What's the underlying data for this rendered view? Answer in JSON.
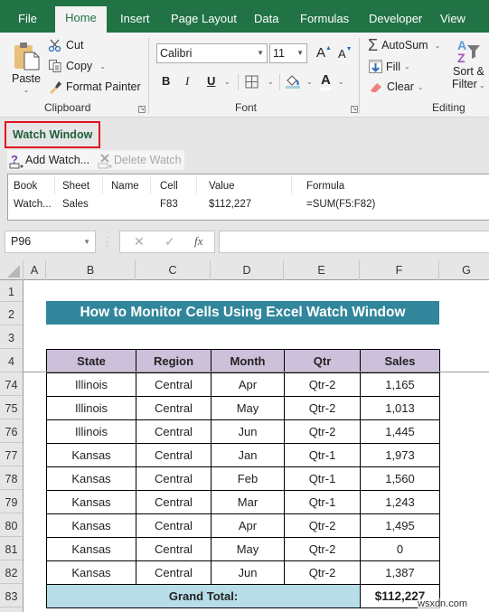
{
  "ribbon_tabs": [
    {
      "label": "File",
      "active": false
    },
    {
      "label": "Home",
      "active": true
    },
    {
      "label": "Insert",
      "active": false
    },
    {
      "label": "Page Layout",
      "active": false
    },
    {
      "label": "Data",
      "active": false
    },
    {
      "label": "Formulas",
      "active": false
    },
    {
      "label": "Developer",
      "active": false
    },
    {
      "label": "View",
      "active": false
    }
  ],
  "clipboard": {
    "paste": "Paste",
    "cut": "Cut",
    "copy": "Copy",
    "format_painter": "Format Painter",
    "group_label": "Clipboard"
  },
  "font": {
    "font_name": "Calibri",
    "font_size": "11",
    "bold": "B",
    "italic": "I",
    "underline": "U",
    "font_color_glyph": "A",
    "grow_glyph": "A",
    "shrink_glyph": "A",
    "group_label": "Font"
  },
  "editing": {
    "autosum": "AutoSum",
    "fill": "Fill",
    "clear": "Clear",
    "sort_filter_line1": "Sort &",
    "sort_filter_line2": "Filter",
    "group_label": "Editing"
  },
  "watch_window": {
    "title": "Watch Window",
    "add_watch": "Add Watch...",
    "delete_watch": "Delete Watch",
    "columns": [
      "Book",
      "Sheet",
      "Name",
      "Cell",
      "Value",
      "Formula"
    ],
    "rows": [
      {
        "book": "Watch...",
        "sheet": "Sales",
        "name": "",
        "cell": "F83",
        "value": "$112,227",
        "formula": "=SUM(F5:F82)"
      }
    ]
  },
  "formula_bar": {
    "name_box": "P96",
    "cancel_glyph": "✕",
    "enter_glyph": "✓",
    "fx_label": "fx",
    "formula_value": ""
  },
  "column_headers": [
    "A",
    "B",
    "C",
    "D",
    "E",
    "F",
    "G"
  ],
  "row_headers": [
    "1",
    "2",
    "3",
    "4",
    "74",
    "75",
    "76",
    "77",
    "78",
    "79",
    "80",
    "81",
    "82",
    "83"
  ],
  "sheet": {
    "title": "How to Monitor Cells Using Excel Watch Window",
    "table_headers": [
      "State",
      "Region",
      "Month",
      "Qtr",
      "Sales"
    ],
    "rows": [
      [
        "Illinois",
        "Central",
        "Apr",
        "Qtr-2",
        "1,165"
      ],
      [
        "Illinois",
        "Central",
        "May",
        "Qtr-2",
        "1,013"
      ],
      [
        "Illinois",
        "Central",
        "Jun",
        "Qtr-2",
        "1,445"
      ],
      [
        "Kansas",
        "Central",
        "Jan",
        "Qtr-1",
        "1,973"
      ],
      [
        "Kansas",
        "Central",
        "Feb",
        "Qtr-1",
        "1,560"
      ],
      [
        "Kansas",
        "Central",
        "Mar",
        "Qtr-1",
        "1,243"
      ],
      [
        "Kansas",
        "Central",
        "Apr",
        "Qtr-2",
        "1,495"
      ],
      [
        "Kansas",
        "Central",
        "May",
        "Qtr-2",
        "0"
      ],
      [
        "Kansas",
        "Central",
        "Jun",
        "Qtr-2",
        "1,387"
      ]
    ],
    "grand_total_label": "Grand Total:",
    "grand_total_value": "$112,227"
  },
  "colors": {
    "ribbon_green": "#217346",
    "title_banner": "#31869b",
    "header_fill": "#ccc0da",
    "total_fill": "#b7dee8",
    "highlight_border": "#e0141e"
  },
  "watermark": "wsxdn.com"
}
